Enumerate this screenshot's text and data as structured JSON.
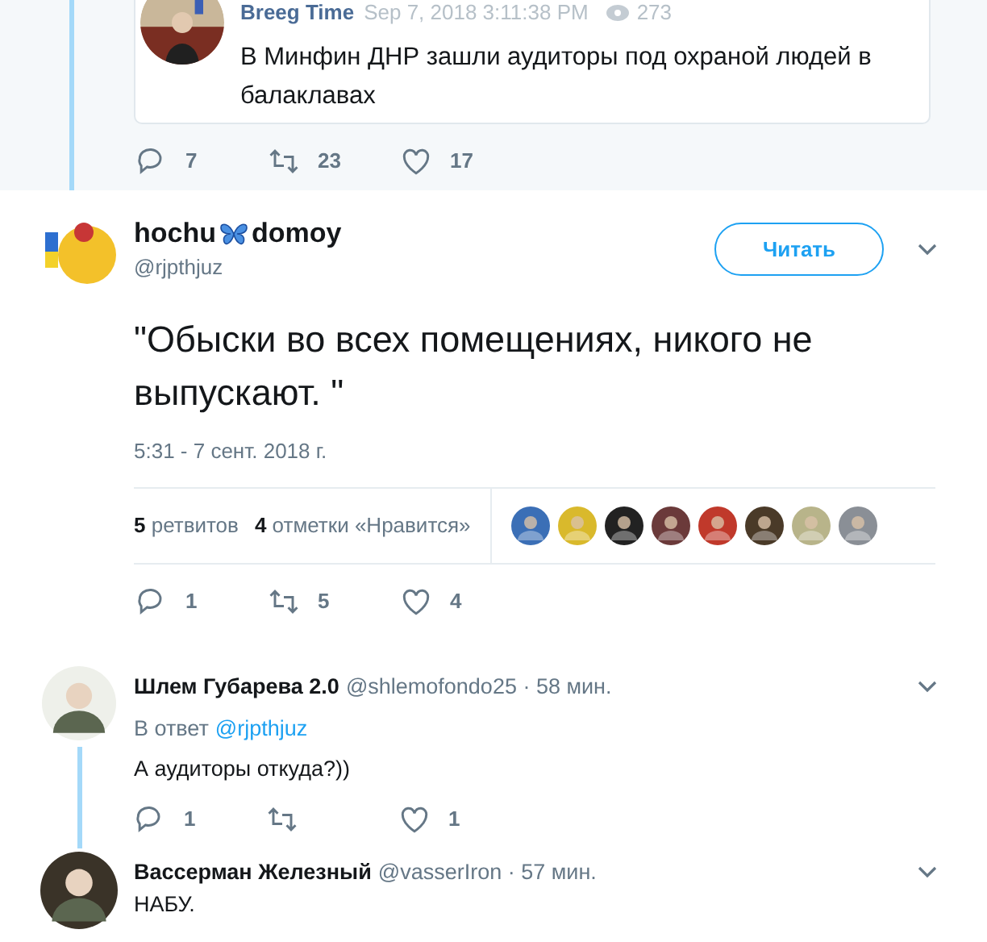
{
  "context": {
    "quoted_tweet": {
      "author": "Breeg Time",
      "date": "Sep 7, 2018 3:11:38 PM",
      "views": "273",
      "text": "В Минфин ДНР зашли аудиторы под охраной людей в балаклавах"
    },
    "actions": {
      "replies": "7",
      "retweets": "23",
      "likes": "17"
    }
  },
  "main_tweet": {
    "name_before": "hochu",
    "name_after": "domoy",
    "handle": "@rjpthjuz",
    "follow_button": "Читать",
    "text": "\"Обыски во всех помещениях, никого не выпускают. \"",
    "timestamp": "5:31 - 7 сент. 2018 г.",
    "retweet_count": "5",
    "retweet_label": "ретвитов",
    "like_count": "4",
    "like_label": "отметки «Нравится»",
    "likers": [
      {
        "color": "#3b6fb6"
      },
      {
        "color": "#d9b92c"
      },
      {
        "color": "#222222"
      },
      {
        "color": "#6b3a3a"
      },
      {
        "color": "#c0392b"
      },
      {
        "color": "#4a3a28"
      },
      {
        "color": "#b8b48a"
      },
      {
        "color": "#8a8f96"
      }
    ],
    "actions": {
      "replies": "1",
      "retweets": "5",
      "likes": "4"
    }
  },
  "replies": [
    {
      "name": "Шлем Губарева 2.0",
      "meta": "@shlemofondo25 · 58 мин.",
      "reply_to_label": "В ответ",
      "reply_to": "@rjpthjuz",
      "text": "А аудиторы откуда?))",
      "thread_continues": true,
      "actions": {
        "replies": "1",
        "likes": "1"
      }
    },
    {
      "name": "Вассерман Железный",
      "meta": "@vasserIron · 57 мин.",
      "text": "НАБУ.",
      "thread_continues": false
    }
  ]
}
